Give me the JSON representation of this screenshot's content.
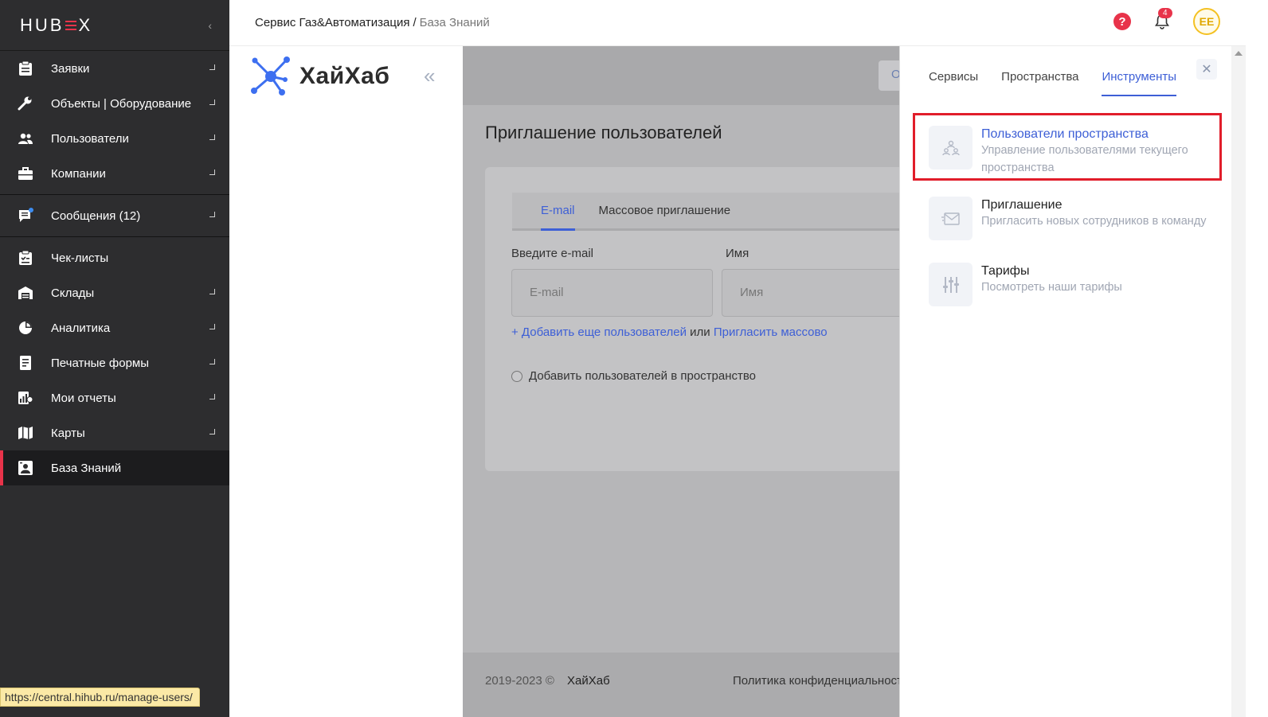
{
  "sidebar": {
    "brand": "HUBEX",
    "collapse_icon": "‹",
    "items": [
      {
        "label": "Заявки",
        "icon": "clipboard-icon",
        "arrow": true
      },
      {
        "label": "Объекты | Оборудование",
        "icon": "wrench-icon",
        "arrow": true
      },
      {
        "label": "Пользователи",
        "icon": "users-icon",
        "arrow": true
      },
      {
        "label": "Компании",
        "icon": "briefcase-icon",
        "arrow": true
      },
      {
        "label": "Сообщения (12)",
        "icon": "chat-icon",
        "arrow": true
      },
      {
        "label": "Чек-листы",
        "icon": "checklist-icon",
        "arrow": false
      },
      {
        "label": "Склады",
        "icon": "warehouse-icon",
        "arrow": true
      },
      {
        "label": "Аналитика",
        "icon": "pie-chart-icon",
        "arrow": true
      },
      {
        "label": "Печатные формы",
        "icon": "print-form-icon",
        "arrow": true
      },
      {
        "label": "Мои отчеты",
        "icon": "reports-icon",
        "arrow": true
      },
      {
        "label": "Карты",
        "icon": "map-icon",
        "arrow": true
      },
      {
        "label": "База Знаний",
        "icon": "knowledge-base-icon",
        "arrow": false,
        "active": true
      }
    ],
    "status_url": "https://central.hihub.ru/manage-users/"
  },
  "header": {
    "breadcrumb_root": "Сервис Газ&Автоматизация",
    "breadcrumb_sep": "/",
    "breadcrumb_current": "База Знаний",
    "notifications_count": "4",
    "avatar_initials": "EE"
  },
  "inner": {
    "logo_text": "ХайХаб",
    "collapse_icon": "«"
  },
  "main": {
    "band_button": "О",
    "page_title": "Приглашение пользователей",
    "tabs": [
      "E-mail",
      "Массовое приглашение"
    ],
    "email_label": "Введите e-mail",
    "email_placeholder": "E-mail",
    "name_label": "Имя",
    "name_placeholder": "Имя",
    "add_more_link": "+ Добавить еще пользователей",
    "or_text": "или",
    "invite_mass_link": "Пригласить массово",
    "checkbox_label": "Добавить пользователей в пространство",
    "footer_copy": "2019-2023 ©",
    "footer_brand": "ХайХаб",
    "footer_policy": "Политика конфиденциальност"
  },
  "drawer": {
    "tabs": [
      "Сервисы",
      "Пространства",
      "Инструменты"
    ],
    "active_tab": 2,
    "close_icon": "✕",
    "tools": [
      {
        "name": "Пользователи пространства",
        "desc": "Управление пользователями текущего пространства",
        "icon": "space-users-icon"
      },
      {
        "name": "Приглашение",
        "desc": "Пригласить новых сотрудников в команду",
        "icon": "envelope-icon"
      },
      {
        "name": "Тарифы",
        "desc": "Посмотреть наши тарифы",
        "icon": "sliders-icon"
      }
    ]
  },
  "colors": {
    "accent": "#3d5fd6",
    "brand_red": "#e8334a",
    "sidebar_bg": "#2d2d2f",
    "highlight": "#e11d2a"
  }
}
